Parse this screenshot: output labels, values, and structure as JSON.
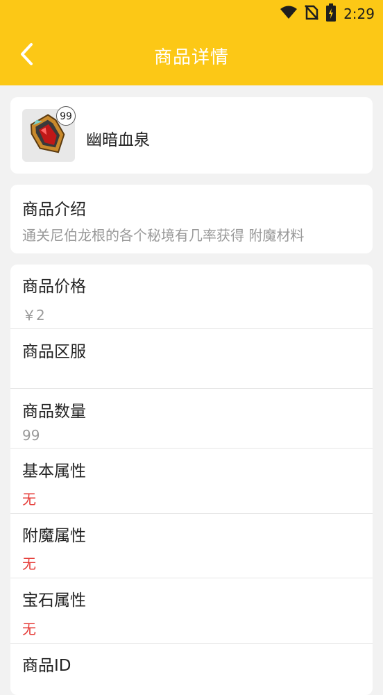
{
  "status_bar": {
    "time": "2:29",
    "icons": [
      "wifi-icon",
      "no-sim-icon",
      "battery-charging-icon"
    ]
  },
  "header": {
    "title": "商品详情",
    "back_icon": "chevron-left-icon"
  },
  "item": {
    "name": "幽暗血泉",
    "quantity_badge": "99",
    "icon": "red-gem-amulet-icon"
  },
  "intro": {
    "label": "商品介绍",
    "text": "通关尼伯龙根的各个秘境有几率获得 附魔材料"
  },
  "details": [
    {
      "label": "商品价格",
      "value": "￥2"
    },
    {
      "label": "商品区服",
      "value": ""
    },
    {
      "label": "商品数量",
      "value": "99"
    },
    {
      "label": "基本属性",
      "value": "无"
    },
    {
      "label": "附魔属性",
      "value": "无"
    },
    {
      "label": "宝石属性",
      "value": "无"
    },
    {
      "label": "商品ID",
      "value": ""
    }
  ],
  "colors": {
    "accent": "#fcc816",
    "warning_text": "#e53935"
  }
}
